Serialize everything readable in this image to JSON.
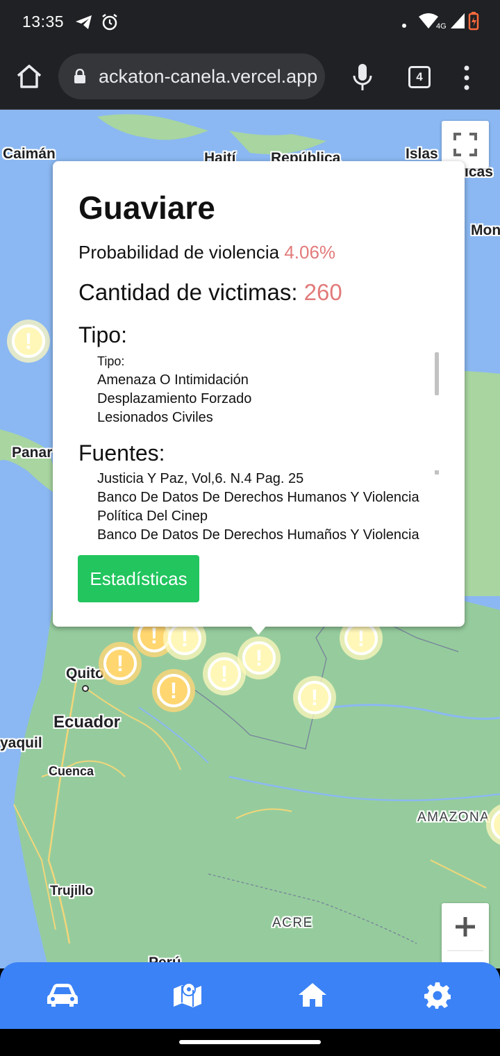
{
  "status_bar": {
    "time": "13:35",
    "network_label": "4G",
    "icons": [
      "telegram-icon",
      "alarm-icon",
      "dot-icon",
      "wifi-icon",
      "signal-icon",
      "battery-icon"
    ]
  },
  "browser": {
    "url": "ackaton-canela.vercel.app",
    "tab_count": "4",
    "icons": [
      "home-icon",
      "lock-icon",
      "mic-icon",
      "tabs-icon",
      "more-vert-icon"
    ]
  },
  "map": {
    "labels": {
      "caiman": "Caimán",
      "haiti": "Haití",
      "republica": "República",
      "islas": "Islas",
      "icas": "icas",
      "mon": "Mon",
      "panama": "Panar",
      "quito": "Quito",
      "ecuador": "Ecuador",
      "guayaquil": "yaquil",
      "cuenca": "Cuenca",
      "amazonas": "AMAZONA",
      "trujillo": "Trujillo",
      "acre": "ACRE",
      "peru": "Perú"
    },
    "marker_glyph": "!",
    "controls": [
      "fullscreen-icon",
      "zoom-in-icon"
    ]
  },
  "info_window": {
    "title": "Guaviare",
    "probability_label": "Probabilidad de violencia",
    "probability_value": "4.06%",
    "victims_label": "Cantidad de victimas:",
    "victims_value": "260",
    "tipo_heading": "Tipo:",
    "tipo_items": [
      "Tipo:",
      "Amenaza O Intimidación",
      "Desplazamiento Forzado",
      "Lesionados Civiles"
    ],
    "fuentes_heading": "Fuentes:",
    "fuentes_items": [
      "Justicia Y Paz, Vol,6. N.4 Pag. 25",
      "Banco De Datos De Derechos Humanos Y Violencia",
      "Política Del Cinep",
      "Banco De Datos De Derechos Humaños Y Violencia"
    ],
    "stats_button": "Estadísticas"
  },
  "bottom_nav": {
    "items": [
      "car-icon",
      "map-icon",
      "home-icon",
      "settings-icon"
    ],
    "color": "#3b82f6"
  },
  "colors": {
    "accent_red": "#e27a7a",
    "button_green": "#22c55e"
  }
}
